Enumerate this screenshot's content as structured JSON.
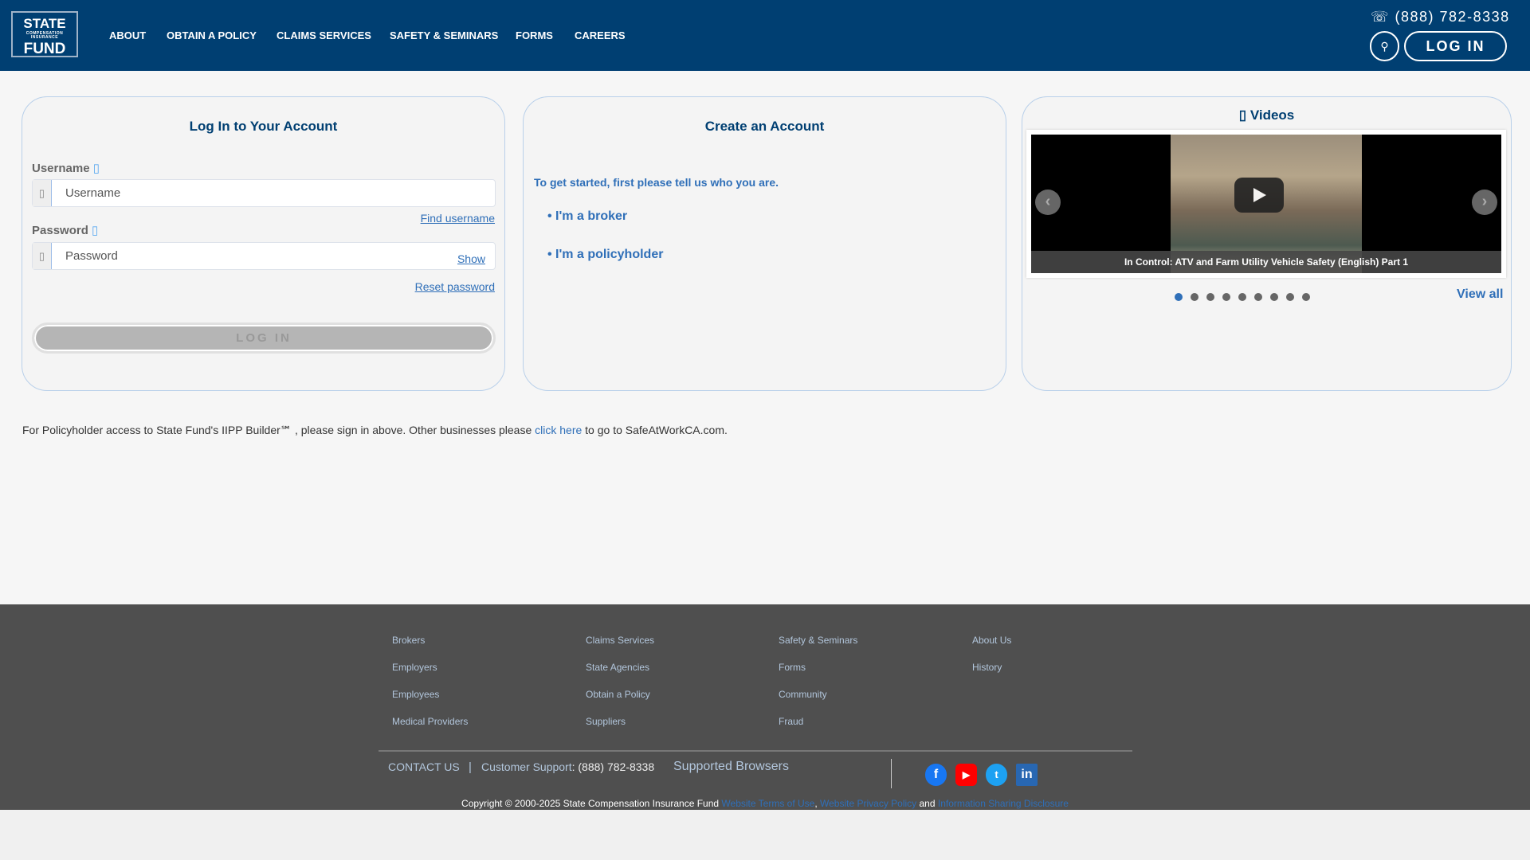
{
  "header": {
    "logo": {
      "line1": "STATE",
      "line2": "COMPENSATION INSURANCE",
      "line3": "FUND"
    },
    "nav": [
      "ABOUT",
      "OBTAIN A POLICY",
      "CLAIMS SERVICES",
      "SAFETY & SEMINARS",
      "FORMS",
      "CAREERS"
    ],
    "phone": "(888) 782-8338",
    "phone_icon": "phone-icon",
    "search_icon": "search-icon",
    "login_label": "LOG IN"
  },
  "login_panel": {
    "title": "Log In to Your Account",
    "username_label": "Username",
    "username_placeholder": "Username",
    "find_username": "Find username",
    "password_label": "Password",
    "password_placeholder": "Password",
    "show": "Show",
    "reset_password": "Reset password",
    "login_button": "LOG IN",
    "info_glyph": "▯"
  },
  "create_panel": {
    "title": "Create an Account",
    "intro": "To get started, first please tell us who you are.",
    "options": [
      "I'm a broker",
      "I'm a policyholder"
    ]
  },
  "videos_panel": {
    "title": "Videos",
    "caption": "In Control: ATV and Farm Utility Vehicle Safety (English) Part 1",
    "prev": "Prev",
    "next": "Next",
    "slide_count": 9,
    "active_slide": 1,
    "view_all": "View all"
  },
  "notice": {
    "before": "For Policyholder access to State Fund's IIPP Builder℠ , please sign in above. Other businesses please ",
    "link": "click here",
    "after": " to go to SafeAtWorkCA.com."
  },
  "footer": {
    "columns": [
      [
        "Brokers",
        "Employers",
        "Employees",
        "Medical Providers"
      ],
      [
        "Claims Services",
        "State Agencies",
        "Obtain a Policy",
        "Suppliers"
      ],
      [
        "Safety & Seminars",
        "Forms",
        "Community",
        "Fraud"
      ],
      [
        "About Us",
        "History"
      ]
    ],
    "contact": "CONTACT US",
    "separator": "|",
    "support_label": "Customer Support",
    "support_phone": ": (888) 782-8338",
    "browsers": "Supported Browsers",
    "social": [
      "facebook",
      "youtube",
      "twitter",
      "linkedin"
    ],
    "copyright": "Copyright © 2000-2025  State Compensation Insurance Fund ",
    "terms": "Website Terms of Use",
    "privacy": "Website Privacy Policy",
    "and": " and ",
    "disclosure": "Information Sharing Disclosure"
  },
  "colors": {
    "brand": "#003f72",
    "link": "#2f6fb8",
    "footer": "#4f4f4f"
  }
}
